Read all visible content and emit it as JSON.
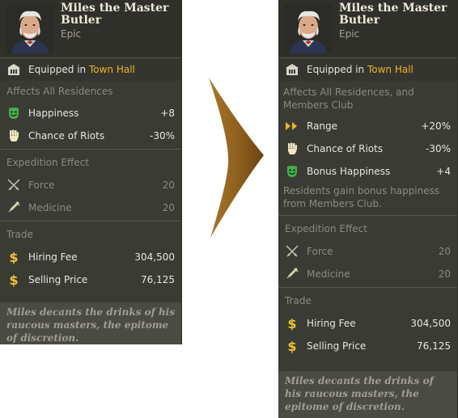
{
  "left": {
    "name": "Miles the Master Butler",
    "rarity": "Epic",
    "equipped_prefix": "Equipped in ",
    "equipped_place": "Town Hall",
    "affects": "Affects All Residences",
    "stats": [
      {
        "label": "Happiness",
        "value": "+8",
        "icon": "happy-mask-icon"
      },
      {
        "label": "Chance of Riots",
        "value": "-30%",
        "icon": "fist-icon"
      }
    ],
    "expedition_title": "Expedition Effect",
    "expedition": [
      {
        "label": "Force",
        "value": "20",
        "icon": "crossed-swords-icon"
      },
      {
        "label": "Medicine",
        "value": "20",
        "icon": "syringe-icon"
      }
    ],
    "trade_title": "Trade",
    "trade": [
      {
        "label": "Hiring Fee",
        "value": "304,500",
        "icon": "dollar-icon"
      },
      {
        "label": "Selling Price",
        "value": "76,125",
        "icon": "dollar-icon"
      }
    ],
    "flavor": "Miles decants the drinks of his raucous masters, the epitome of discretion."
  },
  "right": {
    "name": "Miles the Master Butler",
    "rarity": "Epic",
    "equipped_prefix": "Equipped in ",
    "equipped_place": "Town Hall",
    "affects": "Affects All Residences, and Members Club",
    "stats": [
      {
        "label": "Range",
        "value": "+20%",
        "icon": "double-arrow-icon"
      },
      {
        "label": "Chance of Riots",
        "value": "-30%",
        "icon": "fist-icon"
      },
      {
        "label": "Bonus Happiness",
        "value": "+4",
        "icon": "happy-mask-icon"
      }
    ],
    "bonus_desc": "Residents gain bonus happiness from Members Club.",
    "expedition_title": "Expedition Effect",
    "expedition": [
      {
        "label": "Force",
        "value": "20",
        "icon": "crossed-swords-icon"
      },
      {
        "label": "Medicine",
        "value": "20",
        "icon": "syringe-icon"
      }
    ],
    "trade_title": "Trade",
    "trade": [
      {
        "label": "Hiring Fee",
        "value": "304,500",
        "icon": "dollar-icon"
      },
      {
        "label": "Selling Price",
        "value": "76,125",
        "icon": "dollar-icon"
      }
    ],
    "flavor": "Miles decants the drinks of his raucous masters, the epitome of discretion."
  },
  "colors": {
    "panel": "#3a3b34",
    "accent_gold": "#f0b429",
    "happy_green": "#4caf50",
    "muted_text": "#8d8a80"
  }
}
